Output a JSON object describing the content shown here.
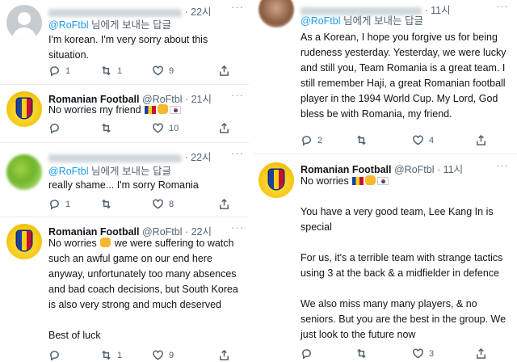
{
  "replying_suffix": "님에게 보내는 답글",
  "left": {
    "tweets": [
      {
        "time": "· 22시",
        "mention": "@RoFtbl",
        "text": "I'm korean. I'm very sorry about this situation.",
        "reply_count": "1",
        "retweet_count": "1",
        "like_count": "9"
      },
      {
        "name": "Romanian Football",
        "handle": "@RoFtbl · 21시",
        "text": "No worries my friend",
        "reply_count": "",
        "retweet_count": "",
        "like_count": "10"
      },
      {
        "time": "· 22시",
        "mention": "@RoFtbl",
        "text": "really shame... I'm sorry Romania",
        "reply_count": "1",
        "retweet_count": "",
        "like_count": "8"
      },
      {
        "name": "Romanian Football",
        "handle": "@RoFtbl · 22시",
        "text_1": "No worries",
        "text_2": "we were suffering to watch such an awful game on our end here anyway, unfortunately too many absences and bad coach decisions, but South Korea is also very strong and much deserved",
        "text_3": "Best of luck",
        "reply_count": "",
        "retweet_count": "1",
        "like_count": "9"
      }
    ]
  },
  "right": {
    "tweets": [
      {
        "time": "· 11시",
        "mention": "@RoFtbl",
        "text": "As a Korean, I hope you forgive us for being rudeness yesterday. Yesterday, we were lucky and still you, Team Romania is a great team. I still remember Haji, a great Romanian football player in the 1994 World Cup. My Lord, God bless be with Romania, my friend.",
        "reply_count": "2",
        "retweet_count": "",
        "like_count": "4"
      },
      {
        "name": "Romanian Football",
        "handle": "@RoFtbl · 11시",
        "text_1": "No worries",
        "text_2": "You have a very good team, Lee Kang In is special",
        "text_3": "For us, it's a terrible team with strange tactics using 3 at the back & a midfielder in defence",
        "text_4": "We also miss many many players, & no seniors. But you are the best in the group. We just look to the future now",
        "reply_count": "",
        "retweet_count": "",
        "like_count": "3"
      }
    ]
  },
  "icons": [
    "reply-icon",
    "retweet-icon",
    "like-icon",
    "share-icon",
    "more-icon"
  ],
  "colors": {
    "link": "#1d9bf0",
    "text": "#0f1419",
    "muted": "#536471"
  }
}
